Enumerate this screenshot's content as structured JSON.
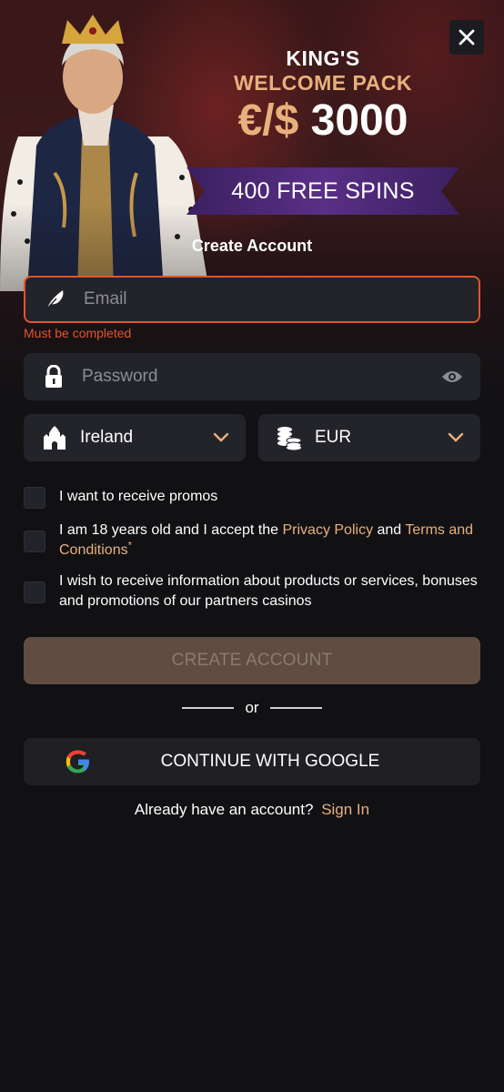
{
  "promo": {
    "line1": "KING'S",
    "line2": "WELCOME PACK",
    "currency": "€/$",
    "amount": "3000",
    "spins": "400 FREE SPINS"
  },
  "form": {
    "title": "Create Account",
    "email_placeholder": "Email",
    "email_error": "Must be completed",
    "password_placeholder": "Password",
    "country": "Ireland",
    "currency": "EUR"
  },
  "checkboxes": {
    "promos": "I want to receive promos",
    "age_prefix": "I am 18 years old and I accept the ",
    "privacy": "Privacy Policy",
    "and": " and ",
    "terms": "Terms and Conditions",
    "required_mark": "*",
    "partners": "I wish to receive information about products or services, bonuses and promotions of our partners casinos"
  },
  "buttons": {
    "create": "CREATE ACCOUNT",
    "or": "or",
    "google": "CONTINUE WITH GOOGLE"
  },
  "signin": {
    "prompt": "Already have an account?",
    "link": "Sign In"
  },
  "colors": {
    "accent": "#e8b07c",
    "error": "#e0542f",
    "field_bg": "#23232a",
    "create_btn_bg": "#5e4d40"
  },
  "icons": [
    "close-icon",
    "feather-icon",
    "lock-icon",
    "eye-icon",
    "castle-icon",
    "coins-icon",
    "chevron-down-icon",
    "google-icon"
  ]
}
